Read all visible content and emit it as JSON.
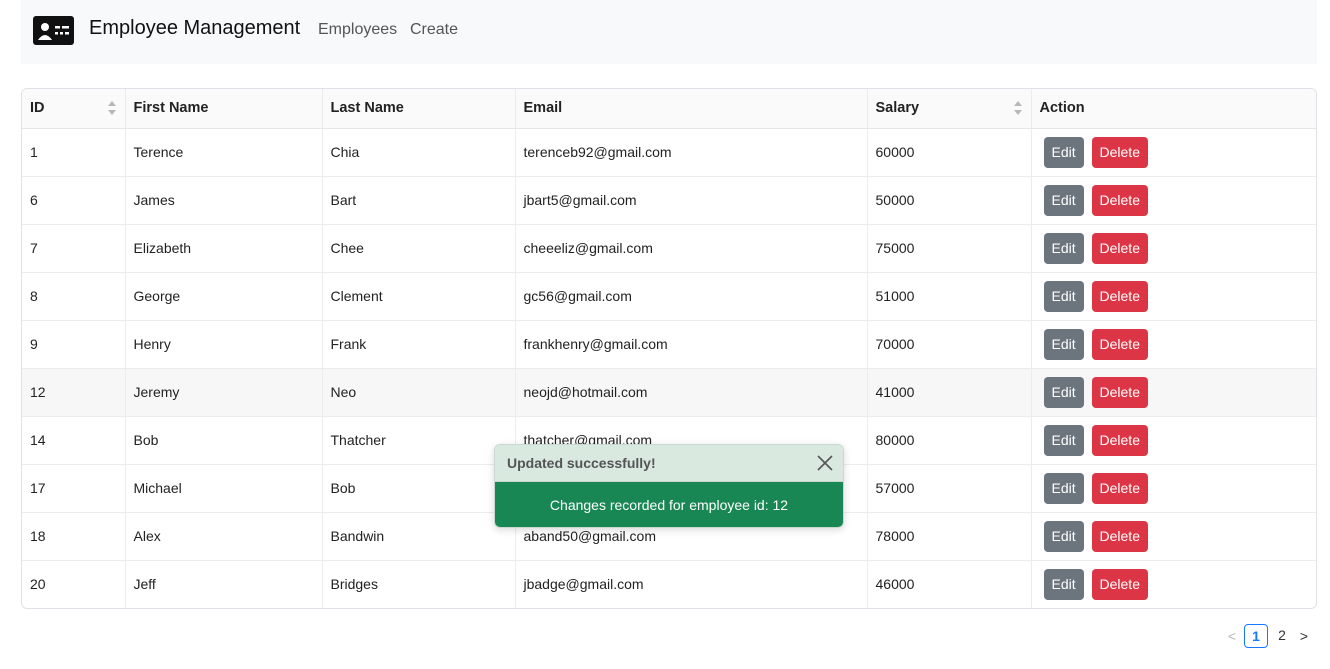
{
  "header": {
    "title": "Employee Management",
    "nav": [
      {
        "label": "Employees"
      },
      {
        "label": "Create"
      }
    ]
  },
  "table": {
    "columns": [
      "ID",
      "First Name",
      "Last Name",
      "Email",
      "Salary",
      "Action"
    ],
    "rows": [
      {
        "id": "1",
        "first": "Terence",
        "last": "Chia",
        "email": "terenceb92@gmail.com",
        "salary": "60000"
      },
      {
        "id": "6",
        "first": "James",
        "last": "Bart",
        "email": "jbart5@gmail.com",
        "salary": "50000"
      },
      {
        "id": "7",
        "first": "Elizabeth",
        "last": "Chee",
        "email": "cheeeliz@gmail.com",
        "salary": "75000"
      },
      {
        "id": "8",
        "first": "George",
        "last": "Clement",
        "email": "gc56@gmail.com",
        "salary": "51000"
      },
      {
        "id": "9",
        "first": "Henry",
        "last": "Frank",
        "email": "frankhenry@gmail.com",
        "salary": "70000"
      },
      {
        "id": "12",
        "first": "Jeremy",
        "last": "Neo",
        "email": "neojd@hotmail.com",
        "salary": "41000"
      },
      {
        "id": "14",
        "first": "Bob",
        "last": "Thatcher",
        "email": "thatcher@gmail.com",
        "salary": "80000"
      },
      {
        "id": "17",
        "first": "Michael",
        "last": "Bob",
        "email": "",
        "salary": "57000"
      },
      {
        "id": "18",
        "first": "Alex",
        "last": "Bandwin",
        "email": "aband50@gmail.com",
        "salary": "78000"
      },
      {
        "id": "20",
        "first": "Jeff",
        "last": "Bridges",
        "email": "jbadge@gmail.com",
        "salary": "46000"
      }
    ],
    "edit_label": "Edit",
    "delete_label": "Delete"
  },
  "pagination": {
    "prev": "<",
    "pages": [
      "1",
      "2"
    ],
    "next": ">"
  },
  "toast": {
    "title": "Updated successfully!",
    "message": "Changes recorded for employee id: 12"
  },
  "colors": {
    "edit": "#6c757d",
    "delete": "#dc3545",
    "toast_body": "#198754",
    "toast_header": "#d9e9df",
    "active_page": "#1677ff"
  }
}
